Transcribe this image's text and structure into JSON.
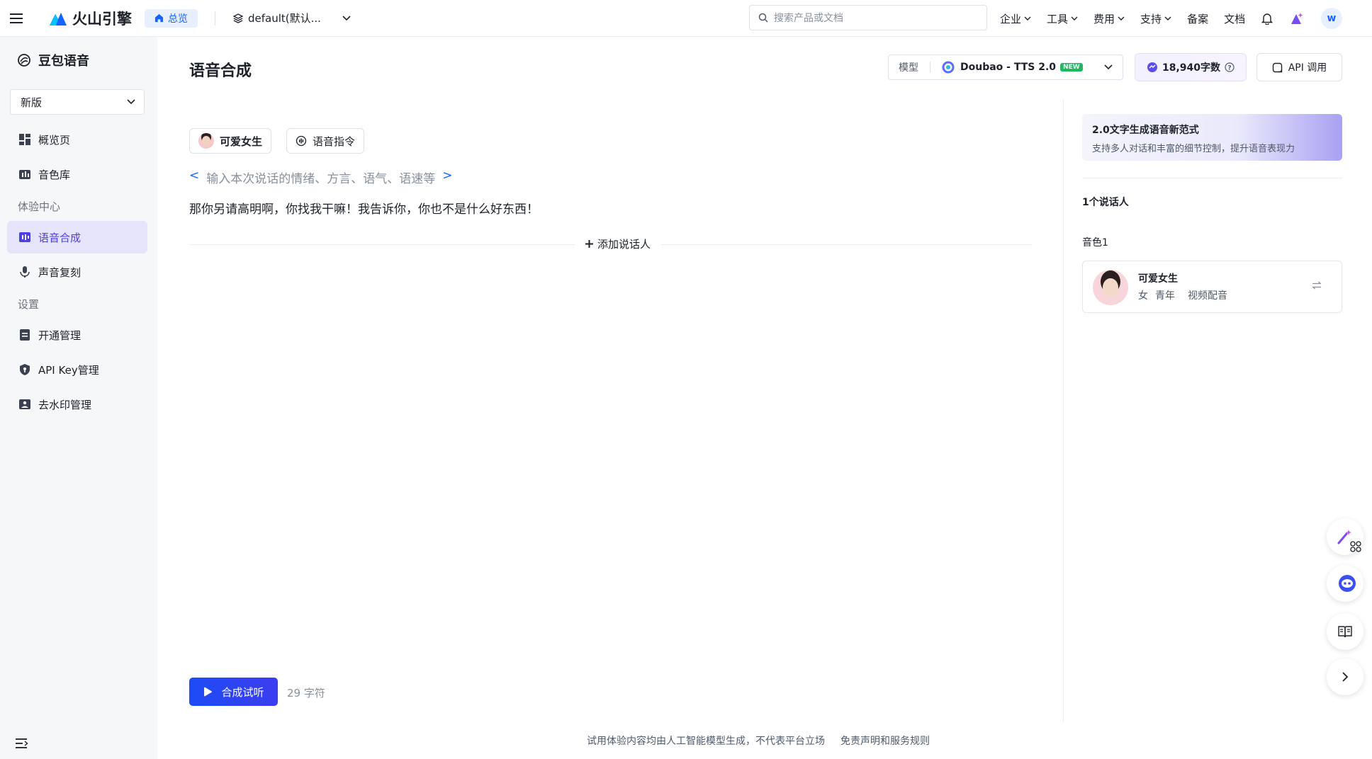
{
  "topbar": {
    "brand": "火山引擎",
    "home_label": "总览",
    "project": "default(默认...",
    "search_placeholder": "搜索产品或文档",
    "nav": [
      "企业",
      "工具",
      "费用",
      "支持",
      "备案",
      "文档"
    ],
    "avatar_letter": "w"
  },
  "sidebar": {
    "title": "豆包语音",
    "version": "新版",
    "items": [
      {
        "label": "概览页",
        "icon": "dashboard-icon"
      },
      {
        "label": "音色库",
        "icon": "voice-library-icon"
      }
    ],
    "group1": "体验中心",
    "group1_items": [
      {
        "label": "语音合成",
        "icon": "speech-synthesis-icon",
        "active": true
      },
      {
        "label": "声音复刻",
        "icon": "microphone-icon"
      }
    ],
    "group2": "设置",
    "group2_items": [
      {
        "label": "开通管理",
        "icon": "document-icon"
      },
      {
        "label": "API Key管理",
        "icon": "shield-icon"
      },
      {
        "label": "去水印管理",
        "icon": "image-icon"
      }
    ]
  },
  "main": {
    "title": "语音合成",
    "model_label": "模型",
    "model_name": "Doubao - TTS 2.0",
    "model_badge": "NEW",
    "chars": "18,940字数",
    "api_label": "API 调用",
    "voice_chip": "可爱女生",
    "command_chip": "语音指令",
    "instruct_open": "<",
    "instruct_placeholder": "输入本次说话的情绪、方言、语气、语速等",
    "instruct_close": ">",
    "script_text": "那你另请高明啊，你找我干嘛！我告诉你，你也不是什么好东西！",
    "add_speaker": "添加说话人",
    "synth_button": "合成试听",
    "char_count": "29 字符"
  },
  "footer": {
    "disclaimer": "试用体验内容均由人工智能模型生成，不代表平台立场",
    "link": "免责声明和服务规则"
  },
  "right_panel": {
    "banner_title": "2.0文字生成语音新范式",
    "banner_sub": "支持多人对话和丰富的细节控制，提升语音表现力",
    "speaker_count": "1个说话人",
    "voice_label": "音色1",
    "voice_name": "可爱女生",
    "voice_tags": [
      "女",
      "青年",
      "视频配音"
    ]
  },
  "colors": {
    "primary": "#1664ff",
    "accent_purple": "#4c3ee8",
    "active_bg": "#e6e4fb"
  }
}
